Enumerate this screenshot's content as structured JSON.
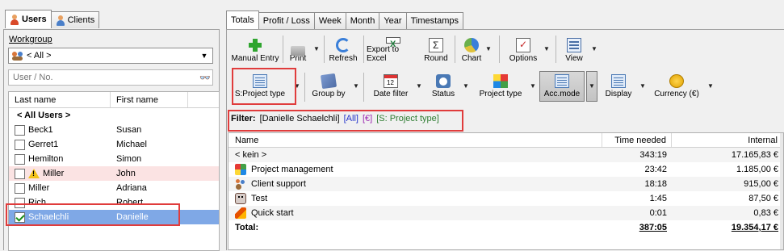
{
  "left": {
    "tabs": [
      {
        "label": "Users",
        "active": true,
        "icon": "user-icon"
      },
      {
        "label": "Clients",
        "active": false,
        "icon": "client-icon"
      }
    ],
    "workgroup_label": "Workgroup",
    "workgroup_value": "< All >",
    "search_placeholder": "User / No.",
    "columns": [
      "Last name",
      "First name"
    ],
    "users": [
      {
        "last": "< All Users >",
        "first": ""
      },
      {
        "last": "Beck1",
        "first": "Susan"
      },
      {
        "last": "Gerret1",
        "first": "Michael"
      },
      {
        "last": "Hemilton",
        "first": "Simon"
      },
      {
        "last": "Miller",
        "first": "John"
      },
      {
        "last": "Miller",
        "first": "Adriana"
      },
      {
        "last": "Rich",
        "first": "Robert"
      },
      {
        "last": "Schaelchli",
        "first": "Danielle"
      }
    ]
  },
  "right": {
    "tabs": [
      "Totals",
      "Profit / Loss",
      "Week",
      "Month",
      "Year",
      "Timestamps"
    ],
    "toolbar1": {
      "manual_entry": "Manual Entry",
      "print": "Print",
      "refresh": "Refresh",
      "export": "Export to Excel",
      "round": "Round",
      "chart": "Chart",
      "options": "Options",
      "view": "View"
    },
    "toolbar2": {
      "project_type_sel": "S:Project type",
      "group_by": "Group by",
      "date_filter": "Date filter",
      "status": "Status",
      "project_type": "Project type",
      "acc_mode": "Acc.mode",
      "display": "Display",
      "currency": "Currency (€)"
    },
    "filter": {
      "label": "Filter:",
      "user": "[Danielle Schaelchli]",
      "all": "[All]",
      "currency": "[€]",
      "ptype": "[S: Project type]"
    },
    "grid": {
      "columns": [
        "Name",
        "Time needed",
        "Internal"
      ],
      "rows": [
        {
          "name": "< kein >",
          "time": "343:19",
          "internal": "17.165,83 €"
        },
        {
          "name": "Project management",
          "time": "23:42",
          "internal": "1.185,00 €"
        },
        {
          "name": "Client support",
          "time": "18:18",
          "internal": "915,00 €"
        },
        {
          "name": "Test",
          "time": "1:45",
          "internal": "87,50 €"
        },
        {
          "name": "Quick start",
          "time": "0:01",
          "internal": "0,83 €"
        }
      ],
      "total": {
        "name": "Total:",
        "time": "387:05",
        "internal": "19.354,17 €"
      }
    }
  }
}
